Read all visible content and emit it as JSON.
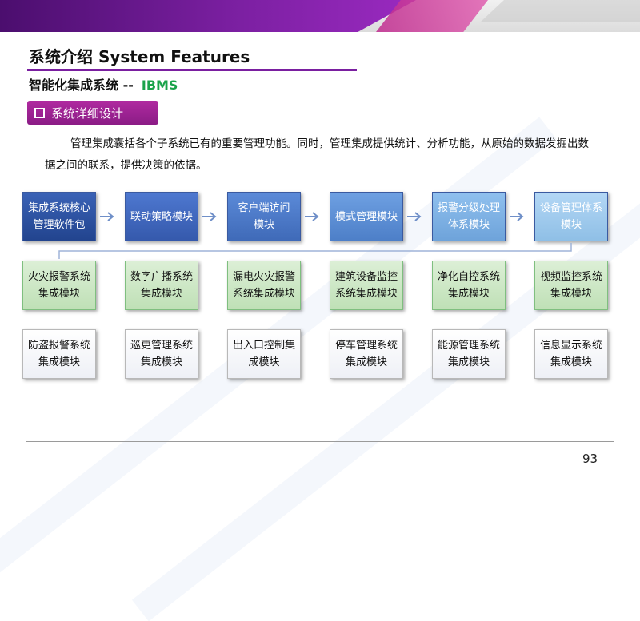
{
  "header": {
    "title": "系统介绍 System Features",
    "subtitle_main": "智能化集成系统 --",
    "subtitle_acronym": "IBMS"
  },
  "section": {
    "tag_label": "系统详细设计"
  },
  "description": "管理集成囊括各个子系统已有的重要管理功能。同时，管理集成提供统计、分析功能，从原始的数据发掘出数据之间的联系，提供决策的依据。",
  "diagram": {
    "rows": [
      [
        {
          "line1": "集成系统核心",
          "line2": "管理软件包"
        },
        {
          "line1": "联动策略模块",
          "line2": ""
        },
        {
          "line1": "客户端访问",
          "line2": "模块"
        },
        {
          "line1": "模式管理模块",
          "line2": ""
        },
        {
          "line1": "报警分级处理",
          "line2": "体系模块"
        },
        {
          "line1": "设备管理体系",
          "line2": "模块"
        }
      ],
      [
        {
          "line1": "火灾报警系统",
          "line2": "集成模块"
        },
        {
          "line1": "数字广播系统",
          "line2": "集成模块"
        },
        {
          "line1": "漏电火灾报警",
          "line2": "系统集成模块"
        },
        {
          "line1": "建筑设备监控",
          "line2": "系统集成模块"
        },
        {
          "line1": "净化自控系统",
          "line2": "集成模块"
        },
        {
          "line1": "视频监控系统",
          "line2": "集成模块"
        }
      ],
      [
        {
          "line1": "防盗报警系统",
          "line2": "集成模块"
        },
        {
          "line1": "巡更管理系统",
          "line2": "集成模块"
        },
        {
          "line1": "出入口控制集",
          "line2": "成模块"
        },
        {
          "line1": "停车管理系统",
          "line2": "集成模块"
        },
        {
          "line1": "能源管理系统",
          "line2": "集成模块"
        },
        {
          "line1": "信息显示系统",
          "line2": "集成模块"
        }
      ]
    ]
  },
  "footer": {
    "page_number": "93"
  },
  "colors": {
    "accent_purple": "#7a1fa0",
    "ibms_green": "#1aa34a",
    "node_blue_dark": "#22448e",
    "node_green": "#bfe0b6"
  }
}
